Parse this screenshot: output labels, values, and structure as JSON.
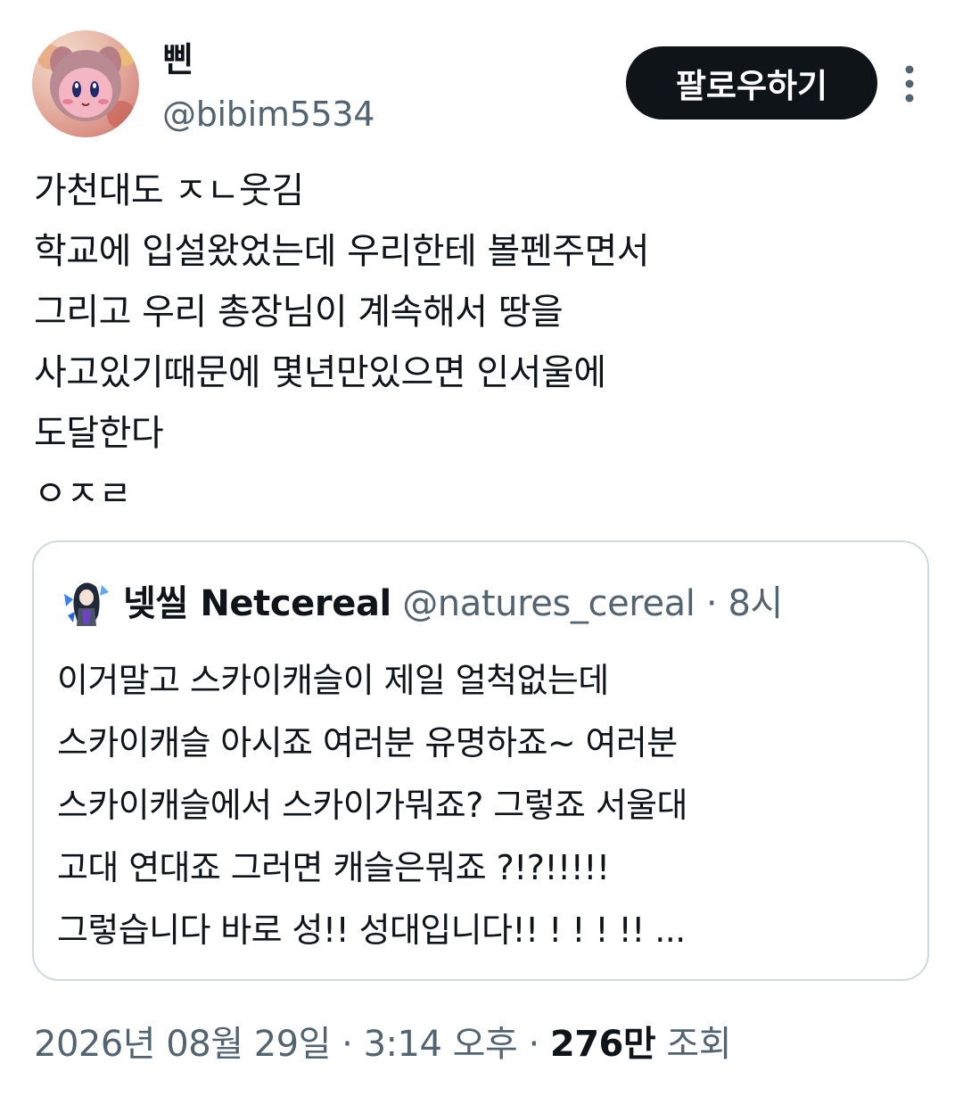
{
  "author": {
    "display_name": "삔",
    "handle": "@bibim5534",
    "avatar_icon": "kirby-plush-avatar"
  },
  "follow_button": {
    "label": "팔로우하기"
  },
  "more_icon": "more-vertical-icon",
  "tweet": {
    "lines": [
      "가천대도 ㅈㄴ웃김",
      "학교에 입설왔었는데 우리한테 볼펜주면서",
      "그리고 우리 총장님이 계속해서 땅을",
      "사고있기때문에 몇년만있으면 인서울에",
      "도달한다",
      "ㅇㅈㄹ"
    ]
  },
  "quote": {
    "display_name": "넺씰 Netcereal",
    "handle": "@natures_cereal",
    "separator": "·",
    "time": "8시",
    "avatar_icon": "anime-character-avatar",
    "lines": [
      "이거말고 스카이캐슬이 제일 얼척없는데",
      "스카이캐슬 아시죠 여러분 유명하죠~ 여러분",
      "스카이캐슬에서 스카이가뭐죠? 그렇죠 서울대",
      "고대 연대죠 그러면 캐슬은뭐죠 ?!?!!!!!",
      "그렇습니다 바로 성!! 성대입니다!! ! ! ! !! ..."
    ]
  },
  "meta": {
    "date": "2026년 08월 29일",
    "sep1": "·",
    "time": "3:14 오후",
    "sep2": "·",
    "views_count": "276만",
    "views_label": "조회"
  },
  "colors": {
    "text_primary": "#0f1419",
    "text_secondary": "#536471",
    "border": "#cfd9de",
    "button_bg": "#0f1419",
    "button_text": "#ffffff"
  }
}
